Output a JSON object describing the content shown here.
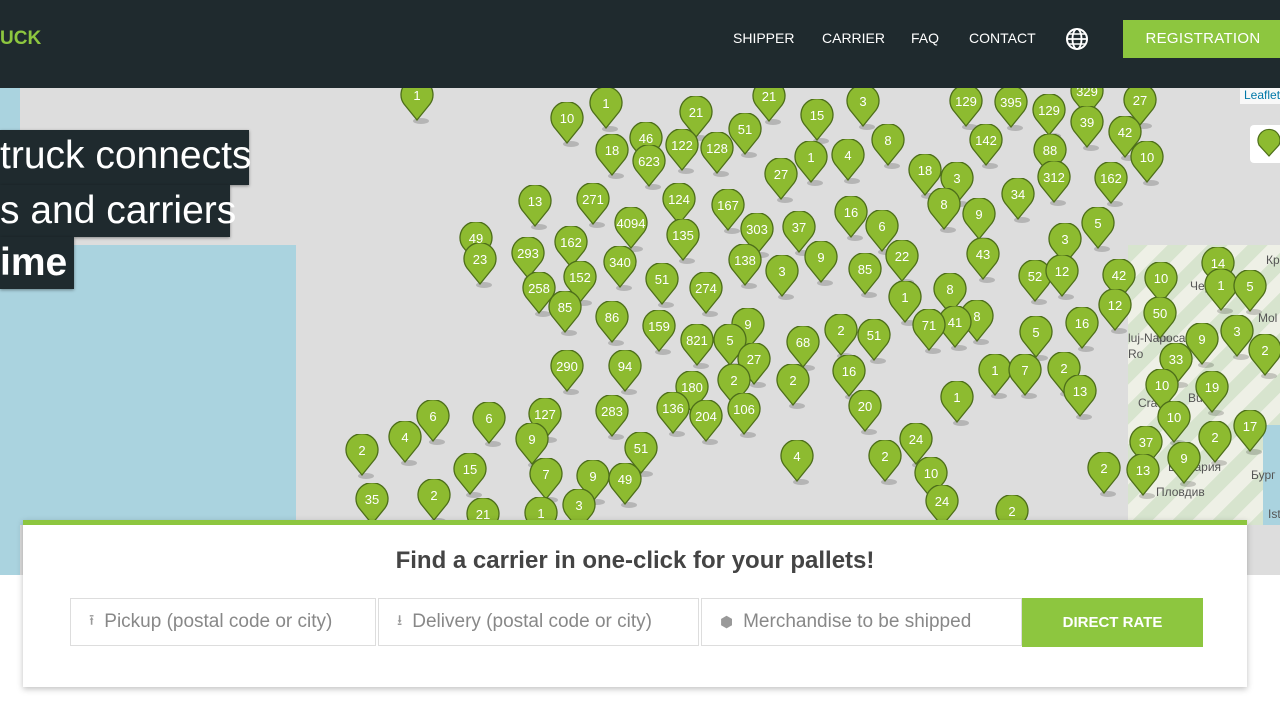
{
  "header": {
    "logo": "UCK",
    "nav": [
      "SHIPPER",
      "CARRIER",
      "FAQ",
      "CONTACT"
    ],
    "language_icon": "globe-icon",
    "registration": "REGISTRATION"
  },
  "hero": {
    "line1": "truck connects",
    "line2": "s and carriers",
    "line3": "ime"
  },
  "map": {
    "attribution": "Leaflet",
    "place_labels": [
      "Кр",
      "Чер",
      "Mol",
      "luj-Napoca",
      "Ro",
      "Cra",
      "Bucu",
      "България",
      "Бург",
      "Пловдив",
      "Ist"
    ],
    "marker_counts": [
      "1",
      "10",
      "1",
      "21",
      "21",
      "15",
      "3",
      "129",
      "395",
      "129",
      "329",
      "27",
      "39",
      "42",
      "10",
      "162",
      "46",
      "122",
      "128",
      "51",
      "18",
      "623",
      "8",
      "142",
      "88",
      "312",
      "1",
      "4",
      "27",
      "18",
      "3",
      "34",
      "8",
      "9",
      "5",
      "13",
      "271",
      "4094",
      "124",
      "167",
      "303",
      "37",
      "16",
      "6",
      "135",
      "162",
      "49",
      "23",
      "293",
      "340",
      "138",
      "3",
      "9",
      "85",
      "22",
      "43",
      "3",
      "52",
      "12",
      "42",
      "10",
      "14",
      "1",
      "5",
      "258",
      "152",
      "51",
      "274",
      "85",
      "86",
      "1",
      "8",
      "8",
      "41",
      "71",
      "12",
      "50",
      "16",
      "5",
      "9",
      "3",
      "2",
      "159",
      "821",
      "9",
      "5",
      "68",
      "2",
      "51",
      "27",
      "33",
      "290",
      "94",
      "16",
      "1",
      "7",
      "2",
      "10",
      "19",
      "2",
      "180",
      "2",
      "13",
      "1",
      "136",
      "204",
      "106",
      "283",
      "127",
      "6",
      "6",
      "20",
      "10",
      "17",
      "2",
      "4",
      "9",
      "2",
      "51",
      "24",
      "37",
      "4",
      "2",
      "9",
      "15",
      "7",
      "9",
      "49",
      "10",
      "2",
      "13",
      "35",
      "2",
      "3",
      "24",
      "21",
      "1",
      "2"
    ],
    "colors": {
      "marker": "#8dbb30",
      "marker_border": "#4d6e1a",
      "sea": "#aad3df",
      "land": "#dddddd"
    }
  },
  "search": {
    "title": "Find a carrier in one-click for your pallets!",
    "pickup_placeholder": "Pickup (postal code or city)",
    "delivery_placeholder": "Delivery (postal code or city)",
    "merch_placeholder": "Merchandise to be shipped",
    "button": "DIRECT RATE"
  },
  "colors": {
    "accent": "#8dc63f",
    "header_bg": "#1f2a2e"
  }
}
